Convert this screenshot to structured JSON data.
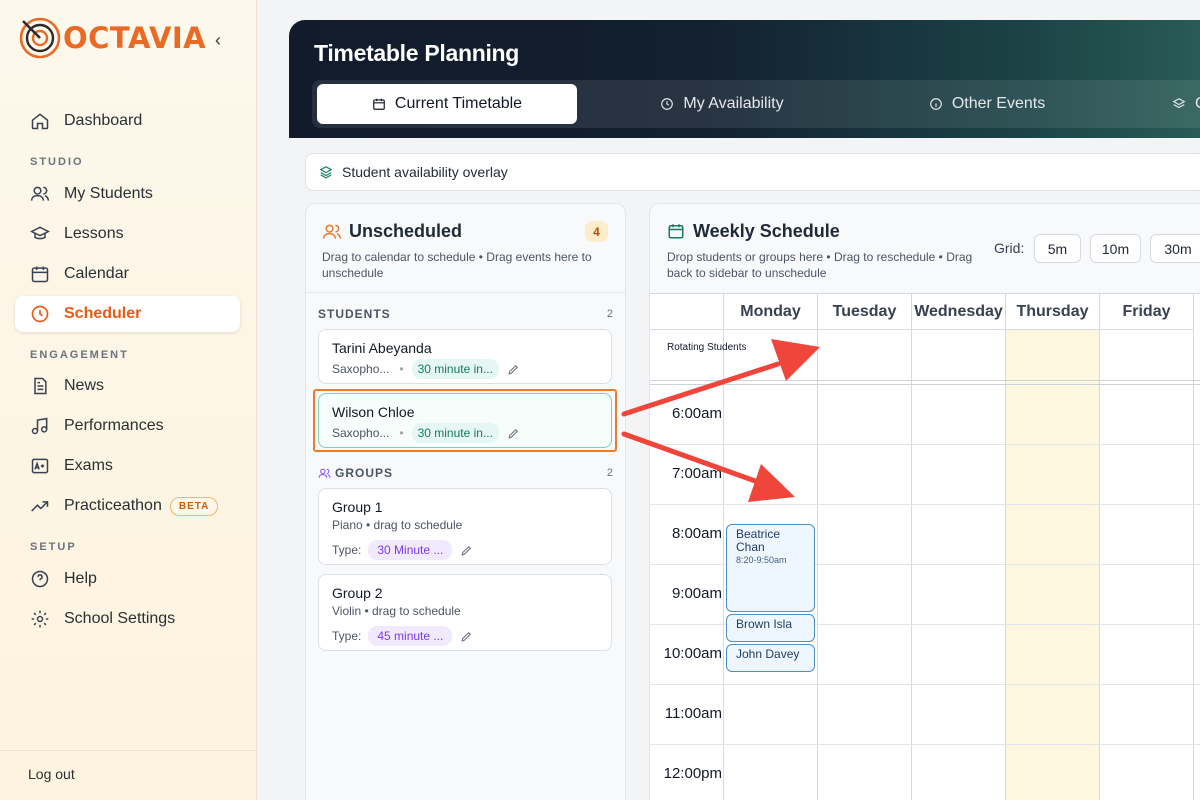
{
  "app": {
    "brand": "OCTAVIA",
    "collapse_glyph": "‹"
  },
  "sidebar": {
    "items": [
      {
        "label": "Dashboard",
        "icon": "home-icon"
      },
      {
        "label": "My Students",
        "icon": "users-icon"
      },
      {
        "label": "Lessons",
        "icon": "graduation-cap-icon"
      },
      {
        "label": "Calendar",
        "icon": "calendar-icon"
      },
      {
        "label": "Scheduler",
        "icon": "clock-icon",
        "active": true
      },
      {
        "label": "News",
        "icon": "document-icon"
      },
      {
        "label": "Performances",
        "icon": "music-note-icon"
      },
      {
        "label": "Exams",
        "icon": "grade-icon"
      },
      {
        "label": "Practiceathon",
        "icon": "trend-up-icon",
        "badge": "BETA"
      },
      {
        "label": "Help",
        "icon": "help-circle-icon"
      },
      {
        "label": "School Settings",
        "icon": "gear-icon"
      }
    ],
    "sections": {
      "studio": "STUDIO",
      "engagement": "ENGAGEMENT",
      "setup": "SETUP"
    },
    "logout": "Log out"
  },
  "header": {
    "title": "Timetable Planning",
    "tabs": [
      {
        "label": "Current Timetable",
        "icon": "calendar-icon",
        "active": true
      },
      {
        "label": "My Availability",
        "icon": "clock-icon"
      },
      {
        "label": "Other Events",
        "icon": "info-icon"
      },
      {
        "label": "C",
        "icon": "layers-icon"
      }
    ]
  },
  "overlay": {
    "label": "Student availability overlay",
    "icon": "layers-icon"
  },
  "unscheduled": {
    "title": "Unscheduled",
    "count": "4",
    "subtitle": "Drag to calendar to schedule • Drag events here to unschedule",
    "students_label": "STUDENTS",
    "students_count": "2",
    "students": [
      {
        "name": "Tarini Abeyanda",
        "instrument": "Saxopho...",
        "duration": "30 minute in..."
      },
      {
        "name": "Wilson Chloe",
        "instrument": "Saxopho...",
        "duration": "30 minute in...",
        "highlighted": true
      }
    ],
    "groups_label": "GROUPS",
    "groups_count": "2",
    "groups": [
      {
        "name": "Group 1",
        "detail": "Piano • drag to schedule",
        "type_label": "Type:",
        "type": "30 Minute ..."
      },
      {
        "name": "Group 2",
        "detail": "Violin • drag to schedule",
        "type_label": "Type:",
        "type": "45 minute ..."
      }
    ]
  },
  "schedule": {
    "title": "Weekly Schedule",
    "subtitle": "Drop students or groups here • Drag to reschedule • Drag back to sidebar to unschedule",
    "grid_label": "Grid:",
    "grid_options": [
      "5m",
      "10m",
      "30m"
    ],
    "days": [
      "Monday",
      "Tuesday",
      "Wednesday",
      "Thursday",
      "Friday"
    ],
    "rotating_label": "Rotating Students",
    "times": [
      "6:00am",
      "7:00am",
      "8:00am",
      "9:00am",
      "10:00am",
      "11:00am",
      "12:00pm"
    ],
    "events": [
      {
        "name": "Beatrice Chan",
        "time": "8:20-9:50am",
        "day": "Monday"
      },
      {
        "name": "Brown Isla",
        "day": "Monday"
      },
      {
        "name": "John Davey",
        "day": "Monday"
      }
    ]
  },
  "colors": {
    "brand": "#ea6a25",
    "accent_teal": "#137a63",
    "highlight": "#ee7b2b",
    "arrow": "#f0453a"
  }
}
